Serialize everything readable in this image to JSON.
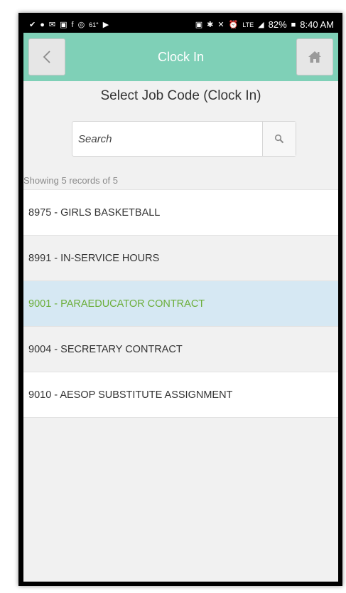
{
  "status_bar": {
    "temperature": "61°",
    "battery": "82%",
    "time": "8:40 AM",
    "signal_label": "LTE"
  },
  "header": {
    "title": "Clock In",
    "back_icon": "chevron-left-icon",
    "home_icon": "home-icon"
  },
  "main": {
    "page_title": "Select Job Code (Clock In)",
    "search": {
      "placeholder": "Search",
      "value": ""
    },
    "records_text": "Showing 5 records of 5",
    "job_codes": [
      {
        "label": "8975 - GIRLS BASKETBALL"
      },
      {
        "label": "8991 - IN-SERVICE HOURS"
      },
      {
        "label": "9001 - PARAEDUCATOR CONTRACT"
      },
      {
        "label": "9004 - SECRETARY CONTRACT"
      },
      {
        "label": "9010 - AESOP SUBSTITUTE ASSIGNMENT"
      }
    ]
  },
  "colors": {
    "header_bg": "#7fd0b7",
    "selected_bg": "#d6e8f3",
    "selected_text": "#6cae3b"
  }
}
